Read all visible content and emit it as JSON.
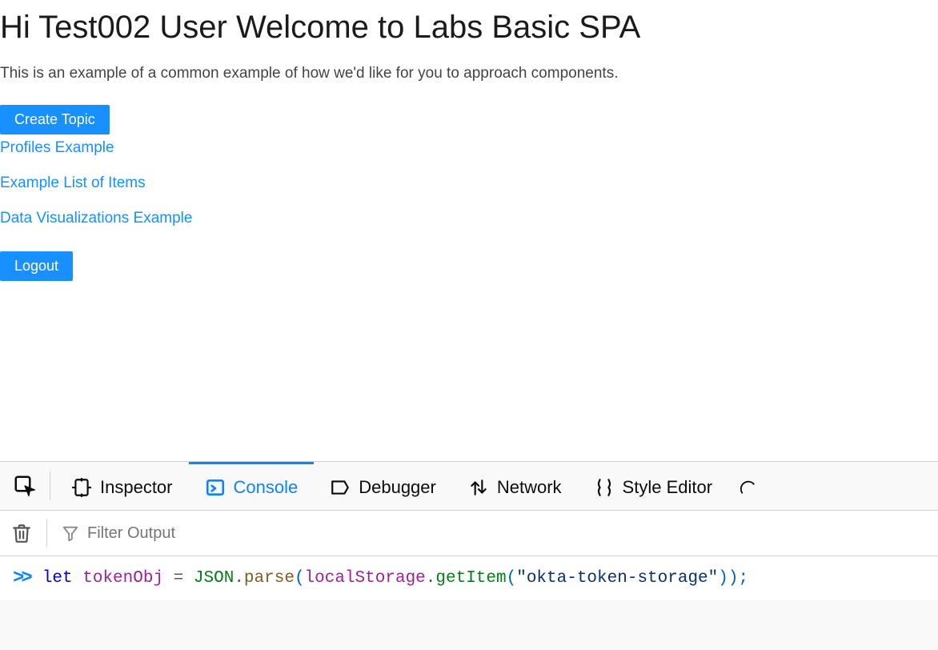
{
  "page": {
    "title": "Hi Test002 User Welcome to Labs Basic SPA",
    "subtitle": "This is an example of a common example of how we'd like for you to approach components.",
    "create_topic_label": "Create Topic",
    "links": {
      "profiles": "Profiles Example",
      "items": "Example List of Items",
      "dataviz": "Data Visualizations Example"
    },
    "logout_label": "Logout"
  },
  "devtools": {
    "tabs": {
      "inspector": "Inspector",
      "console": "Console",
      "debugger": "Debugger",
      "network": "Network",
      "style_editor": "Style Editor"
    },
    "active_tab": "console",
    "filter_placeholder": "Filter Output",
    "console_line": {
      "prompt": ">>",
      "kw": "let",
      "ident": "tokenObj",
      "eq": "=",
      "json_obj": "JSON",
      "parse_fn": "parse",
      "ls_obj": "localStorage",
      "get_fn": "getItem",
      "string_arg": "\"okta-token-storage\"",
      "close": "));"
    }
  },
  "colors": {
    "accent": "#1890ff",
    "devtools_active": "#0a84ff"
  }
}
